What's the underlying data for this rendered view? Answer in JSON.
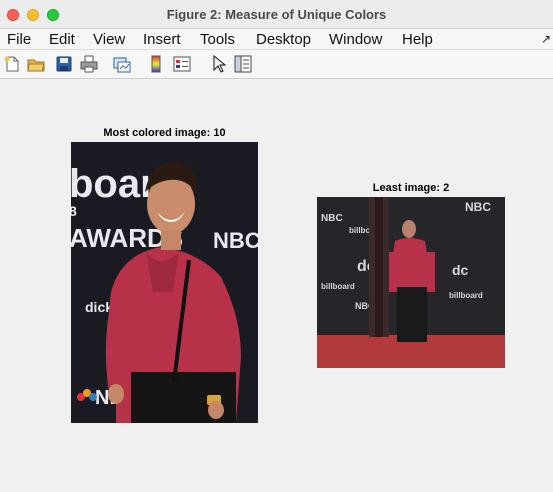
{
  "window": {
    "title": "Figure 2: Measure of Unique Colors"
  },
  "menu": [
    "File",
    "Edit",
    "View",
    "Insert",
    "Tools",
    "Desktop",
    "Window",
    "Help"
  ],
  "toolbar": {
    "icons": [
      "new-file-icon",
      "open-folder-icon",
      "save-icon",
      "print-icon",
      "link-plot-icon",
      "colorbar-icon",
      "legend-icon",
      "pointer-icon",
      "property-inspector-icon"
    ]
  },
  "figure": {
    "left_title": "Most colored image: 10",
    "right_title": "Least image: 2",
    "left_photo_text": [
      "board",
      "AWARDS",
      "8",
      "NBC",
      "dick",
      "NBC"
    ],
    "right_photo_text": [
      "NBC",
      "dc",
      "billboard",
      "NBC",
      "dc",
      "NBC",
      "billboard",
      "billboard"
    ]
  }
}
